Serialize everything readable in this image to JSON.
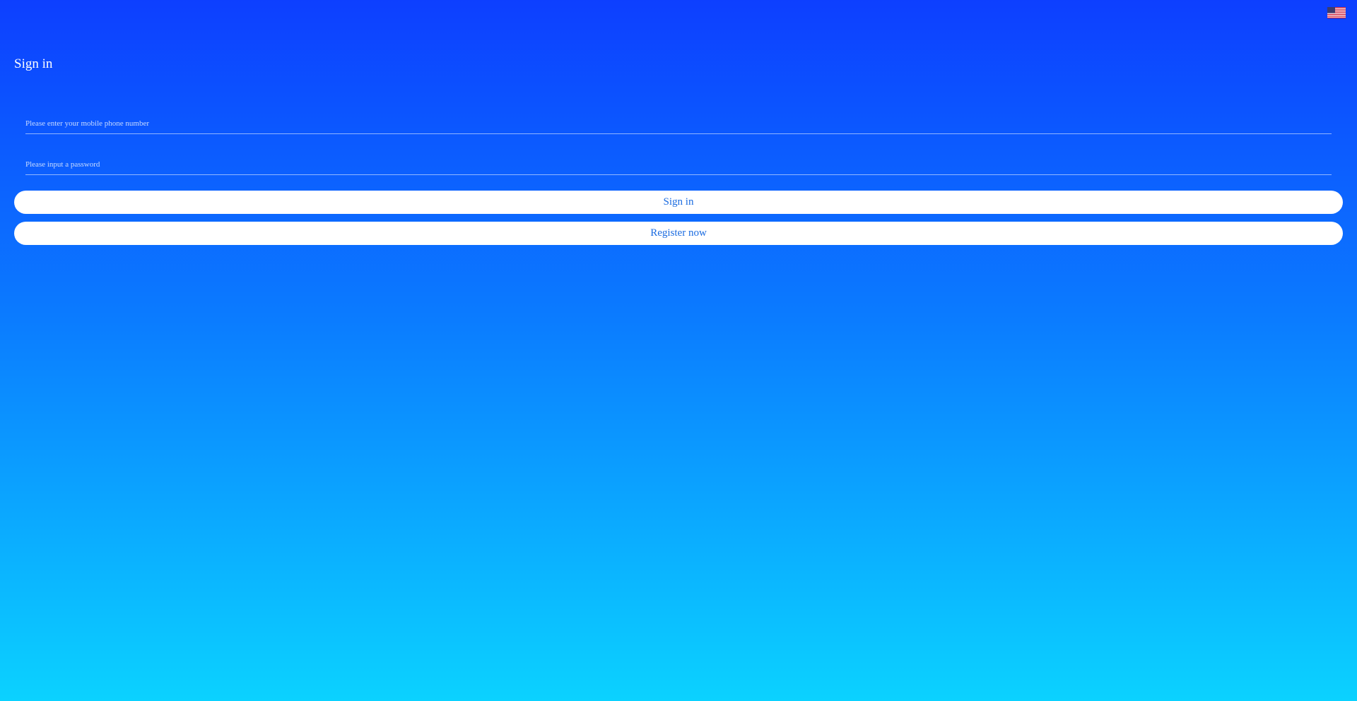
{
  "header": {
    "language_icon": "us-flag-icon"
  },
  "page": {
    "title": "Sign in"
  },
  "form": {
    "phone": {
      "value": "",
      "placeholder": "Please enter your mobile phone number"
    },
    "password": {
      "value": "",
      "placeholder": "Please input a password"
    },
    "signin_label": "Sign in",
    "register_label": "Register now"
  },
  "colors": {
    "gradient_top": "#0d3fff",
    "gradient_bottom": "#0bd2ff",
    "button_text": "#1a6be0"
  }
}
